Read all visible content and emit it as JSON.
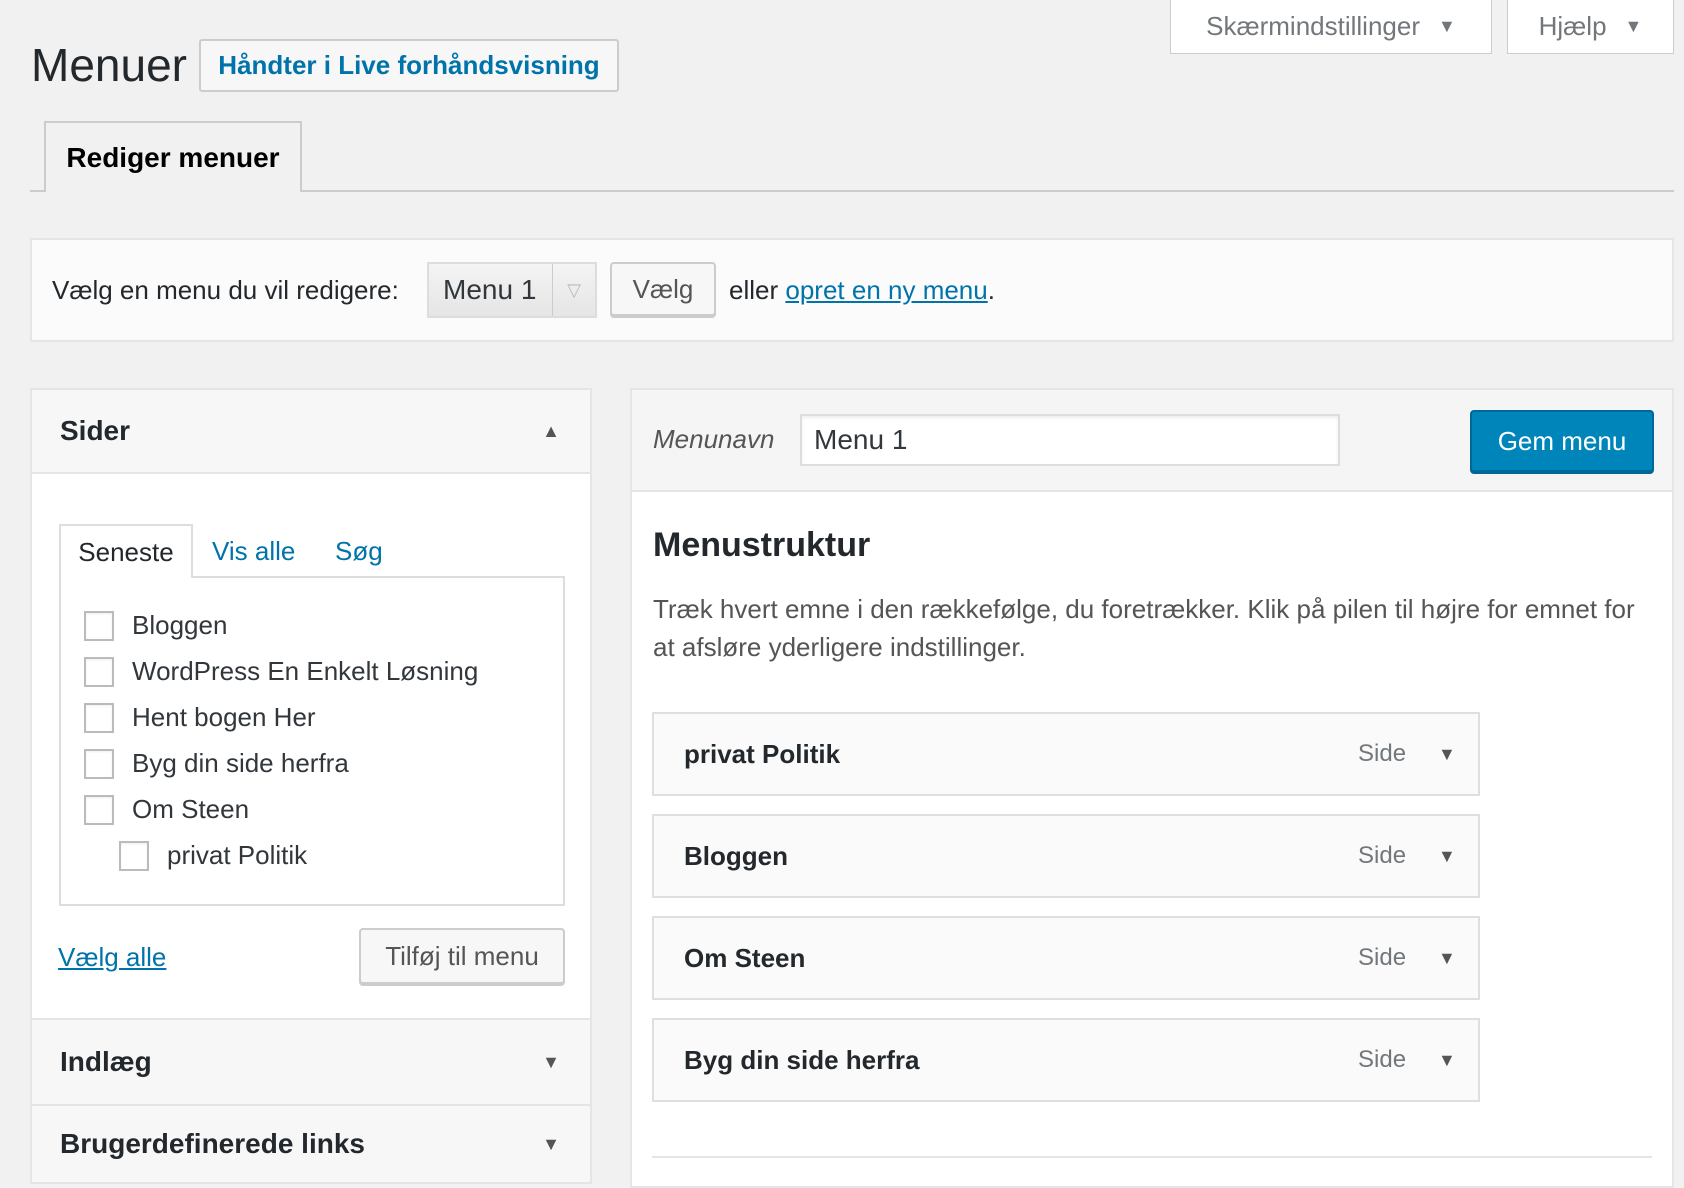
{
  "screen_options": {
    "screen_label": "Skærmindstillinger",
    "help_label": "Hjælp"
  },
  "header": {
    "title": "Menuer",
    "live_button": "Håndter i Live forhåndsvisning"
  },
  "tabs": {
    "active": "Rediger menuer"
  },
  "select_menu": {
    "label": "Vælg en menu du vil redigere:",
    "selected": "Menu 1",
    "choose_button": "Vælg",
    "or_text": "eller",
    "create_link": "opret en ny menu",
    "period": "."
  },
  "pages_box": {
    "title": "Sider",
    "tabs": [
      "Seneste",
      "Vis alle",
      "Søg"
    ],
    "items": [
      {
        "label": "Bloggen"
      },
      {
        "label": "WordPress En Enkelt Løsning"
      },
      {
        "label": "Hent bogen Her"
      },
      {
        "label": "Byg din side herfra"
      },
      {
        "label": "Om Steen"
      },
      {
        "label": "privat Politik"
      }
    ],
    "select_all": "Vælg alle",
    "add_button": "Tilføj til menu"
  },
  "other_boxes": {
    "posts": "Indlæg",
    "links": "Brugerdefinerede links"
  },
  "menu_edit": {
    "name_label": "Menunavn",
    "name_value": "Menu 1",
    "save_button": "Gem menu",
    "structure_title": "Menustruktur",
    "description": "Træk hvert emne i den rækkefølge, du foretrækker. Klik på pilen til højre for emnet for at afsløre yderligere indstillinger.",
    "items": [
      {
        "title": "privat Politik",
        "type": "Side"
      },
      {
        "title": "Bloggen",
        "type": "Side"
      },
      {
        "title": "Om Steen",
        "type": "Side"
      },
      {
        "title": "Byg din side herfra",
        "type": "Side"
      }
    ]
  },
  "colors": {
    "accent": "#0073aa",
    "primary_button": "#0085ba",
    "background": "#f1f1f1"
  }
}
